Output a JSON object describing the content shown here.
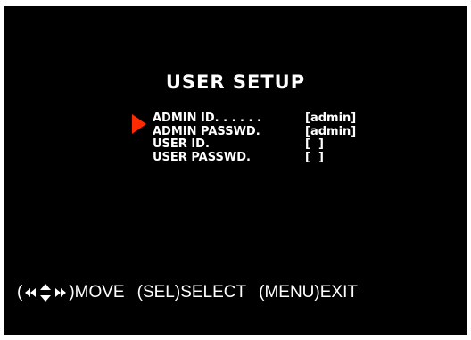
{
  "screen": {
    "title": "USER SETUP",
    "selected_index": 0,
    "accent_color": "#ff2a00"
  },
  "menu": {
    "items": [
      {
        "label": "ADMIN ID. . . . . .",
        "value": "[admin]"
      },
      {
        "label": "ADMIN PASSWD.",
        "value": "[admin]"
      },
      {
        "label": "USER ID.",
        "value": "[  ]"
      },
      {
        "label": "USER PASSWD.",
        "value": "[  ]"
      }
    ]
  },
  "footer": {
    "nav_icon": "arrow-keys-icon",
    "move_label": "MOVE",
    "sel_key": "SEL",
    "select_label": "SELECT",
    "menu_key": "MENU",
    "exit_label": "EXIT"
  }
}
